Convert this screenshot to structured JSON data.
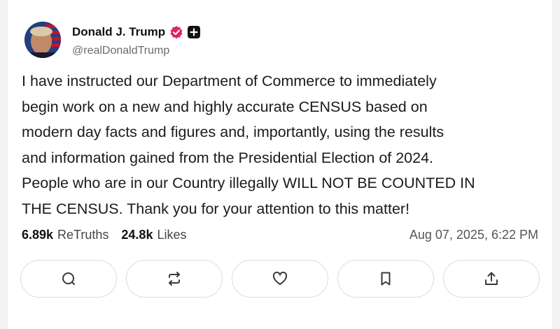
{
  "author": {
    "name": "Donald J. Trump",
    "handle": "@realDonaldTrump",
    "verified_color": "#e0245e"
  },
  "post": {
    "text": "I have instructed our Department of Commerce to immediately\nbegin work on a new and highly accurate CENSUS based on\nmodern day facts and figures and, importantly, using the results\nand information gained from the Presidential Election of 2024.\nPeople who are in our Country illegally WILL NOT BE COUNTED IN\nTHE CENSUS. Thank you for your attention to this matter!"
  },
  "stats": {
    "retruths_count": "6.89k",
    "retruths_label": "ReTruths",
    "likes_count": "24.8k",
    "likes_label": "Likes",
    "date": "Aug 07, 2025, 6:22 PM"
  },
  "actions": [
    {
      "icon": "reply-icon"
    },
    {
      "icon": "retruth-icon"
    },
    {
      "icon": "heart-icon"
    },
    {
      "icon": "bookmark-icon"
    },
    {
      "icon": "share-icon"
    }
  ]
}
